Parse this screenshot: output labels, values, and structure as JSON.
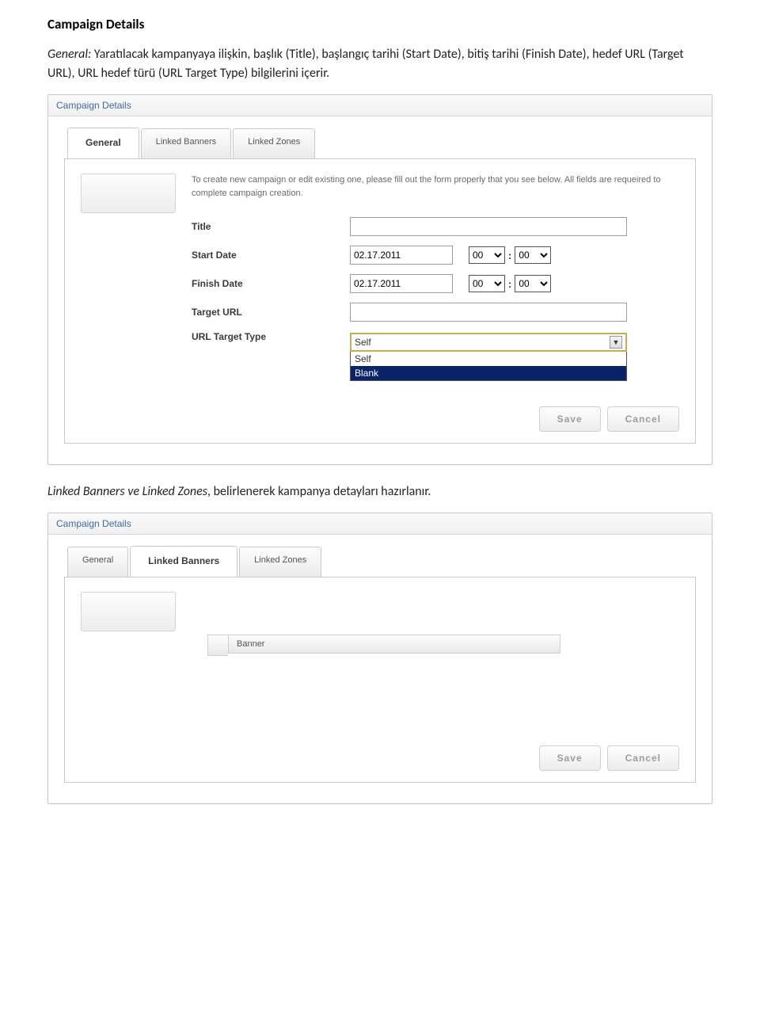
{
  "doc": {
    "heading": "Campaign Details",
    "general_label": "General:",
    "para1_rest": " Yaratılacak kampanyaya ilişkin, başlık (Title), başlangıç tarihi (Start Date), bitiş tarihi (Finish Date), hedef URL (Target URL), URL hedef türü (URL Target Type) bilgilerini içerir.",
    "para2_italic": "Linked Banners ve Linked Zones",
    "para2_rest": ", belirlenerek kampanya detayları hazırlanır."
  },
  "panel1": {
    "title": "Campaign Details",
    "tabs": {
      "general": "General",
      "linked_banners": "Linked Banners",
      "linked_zones": "Linked Zones"
    },
    "intro": "To create new campaign or edit existing one, please fill out the form properly that you see below. All fields are requeired to complete campaign creation.",
    "labels": {
      "title": "Title",
      "start_date": "Start Date",
      "finish_date": "Finish Date",
      "target_url": "Target URL",
      "url_target_type": "URL Target Type"
    },
    "values": {
      "title": "",
      "start_date": "02.17.2011",
      "start_hh": "00",
      "start_mm": "00",
      "finish_date": "02.17.2011",
      "finish_hh": "00",
      "finish_mm": "00",
      "target_url": "",
      "url_target_type_selected": "Self",
      "url_target_type_options": {
        "opt0": "Self",
        "opt1": "Blank"
      }
    },
    "buttons": {
      "save": "Save",
      "cancel": "Cancel"
    }
  },
  "panel2": {
    "title": "Campaign Details",
    "tabs": {
      "general": "General",
      "linked_banners": "Linked Banners",
      "linked_zones": "Linked Zones"
    },
    "table": {
      "col_banner": "Banner"
    },
    "buttons": {
      "save": "Save",
      "cancel": "Cancel"
    }
  }
}
